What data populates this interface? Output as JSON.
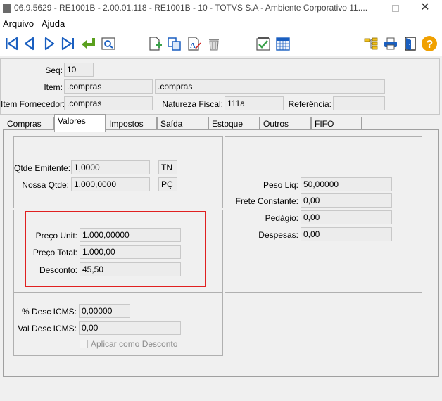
{
  "window": {
    "title": "06.9.5629 - RE1001B - 2.00.01.118 - RE1001B - 10 - TOTVS S.A - Ambiente Corporativo 11....",
    "close_glyph": "✕"
  },
  "menu": {
    "items": [
      "Arquivo",
      "Ajuda"
    ]
  },
  "header": {
    "seq_label": "Seq:",
    "seq_value": "10",
    "item_label": "Item:",
    "item_code": ".compras",
    "item_desc": ".compras",
    "item_fornecedor_label": "Item Fornecedor:",
    "item_fornecedor_value": ".compras",
    "natureza_fiscal_label": "Natureza Fiscal:",
    "natureza_fiscal_value": "111a",
    "referencia_label": "Referência:",
    "referencia_value": ""
  },
  "tabs": [
    "Compras",
    "Valores",
    "Impostos",
    "Saída",
    "Estoque",
    "Outros",
    "FIFO"
  ],
  "active_tab": "Valores",
  "valores": {
    "qtde_emitente_label": "Qtde Emitente:",
    "qtde_emitente_value": "1,0000",
    "qtde_emitente_unit": "TN",
    "nossa_qtde_label": "Nossa Qtde:",
    "nossa_qtde_value": "1.000,0000",
    "nossa_qtde_unit": "PÇ",
    "preco_unit_label": "Preço Unit:",
    "preco_unit_value": "1.000,00000",
    "preco_total_label": "Preço Total:",
    "preco_total_value": "1.000,00",
    "desconto_label": "Desconto:",
    "desconto_value": "45,50",
    "peso_liq_label": "Peso Liq:",
    "peso_liq_value": "50,00000",
    "frete_label": "Frete Constante:",
    "frete_value": "0,00",
    "pedagio_label": "Pedágio:",
    "pedagio_value": "0,00",
    "despesas_label": "Despesas:",
    "despesas_value": "0,00",
    "desc_icms_pct_label": "% Desc ICMS:",
    "desc_icms_pct_value": "0,00000",
    "val_desc_icms_label": "Val Desc ICMS:",
    "val_desc_icms_value": "0,00",
    "aplicar_desconto_label": "Aplicar como Desconto"
  },
  "colors": {
    "highlight": "#e02020",
    "help": "#f0a000",
    "nav": "#1a5fc0"
  }
}
